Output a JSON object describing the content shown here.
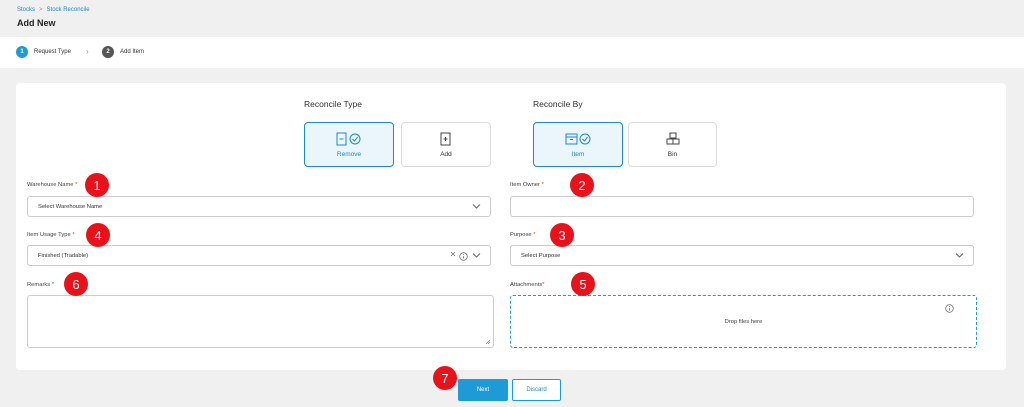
{
  "breadcrumb": {
    "items": [
      "Stocks",
      "Stock Reconcile"
    ],
    "separator": ">"
  },
  "page": {
    "title": "Add New"
  },
  "steps": [
    {
      "number": "1",
      "label": "Request Type"
    },
    {
      "number": "2",
      "label": "Add Item"
    }
  ],
  "reconcile_type": {
    "title": "Reconcile Type",
    "options": [
      {
        "label": "Remove",
        "selected": true,
        "icon": "clipboard-remove-icon"
      },
      {
        "label": "Add",
        "selected": false,
        "icon": "clipboard-add-icon"
      }
    ]
  },
  "reconcile_by": {
    "title": "Reconcile By",
    "options": [
      {
        "label": "Item",
        "selected": true,
        "icon": "box-icon"
      },
      {
        "label": "Bin",
        "selected": false,
        "icon": "boxes-icon"
      }
    ]
  },
  "form": {
    "warehouse": {
      "label": "Warehouse Name",
      "required": "*",
      "value": "Select Warehouse Name"
    },
    "item_owner": {
      "label": "Item Owner",
      "required": "*",
      "value": ""
    },
    "item_usage_type": {
      "label": "Item Usage Type",
      "required": "*",
      "value": "Finished (Tradable)"
    },
    "purpose": {
      "label": "Purpose",
      "required": "*",
      "value": "Select Purpose"
    },
    "remarks": {
      "label": "Remarks",
      "required": "*",
      "value": ""
    },
    "attachments": {
      "label": "Attachments",
      "required": "*",
      "drop_text": "Drop files here"
    }
  },
  "badges": [
    "1",
    "2",
    "3",
    "4",
    "5",
    "6",
    "7"
  ],
  "actions": {
    "next": "Next",
    "discard": "Discard"
  },
  "colors": {
    "accent": "#1e9ad6",
    "badge": "#e8121b",
    "required": "#e53935"
  }
}
